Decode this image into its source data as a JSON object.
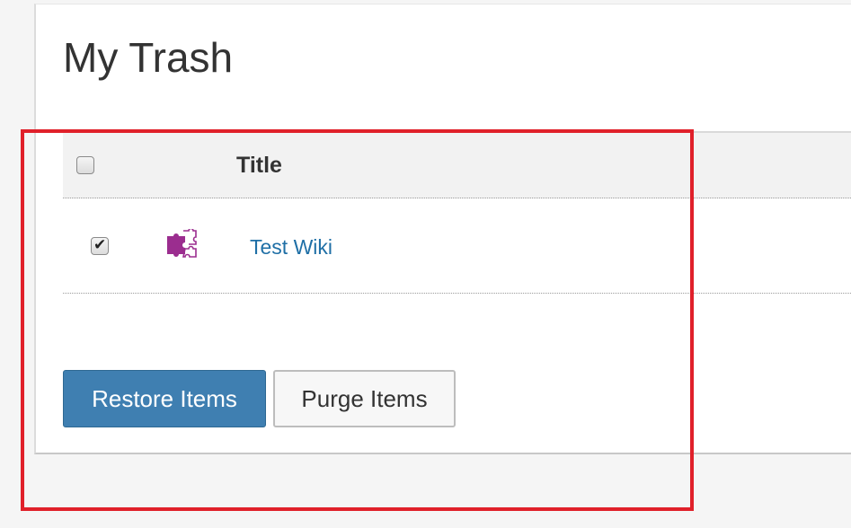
{
  "page": {
    "title": "My Trash"
  },
  "table": {
    "columns": {
      "title": "Title"
    },
    "select_all_checked": false,
    "rows": [
      {
        "icon": "puzzle-piece-icon",
        "title": "Test Wiki",
        "checked": true
      }
    ]
  },
  "actions": {
    "restore_label": "Restore Items",
    "purge_label": "Purge Items"
  },
  "colors": {
    "accent_button": "#3f7fb1",
    "link": "#1f6fa6",
    "icon": "#9b2d8f",
    "highlight_border": "#e0202a"
  }
}
